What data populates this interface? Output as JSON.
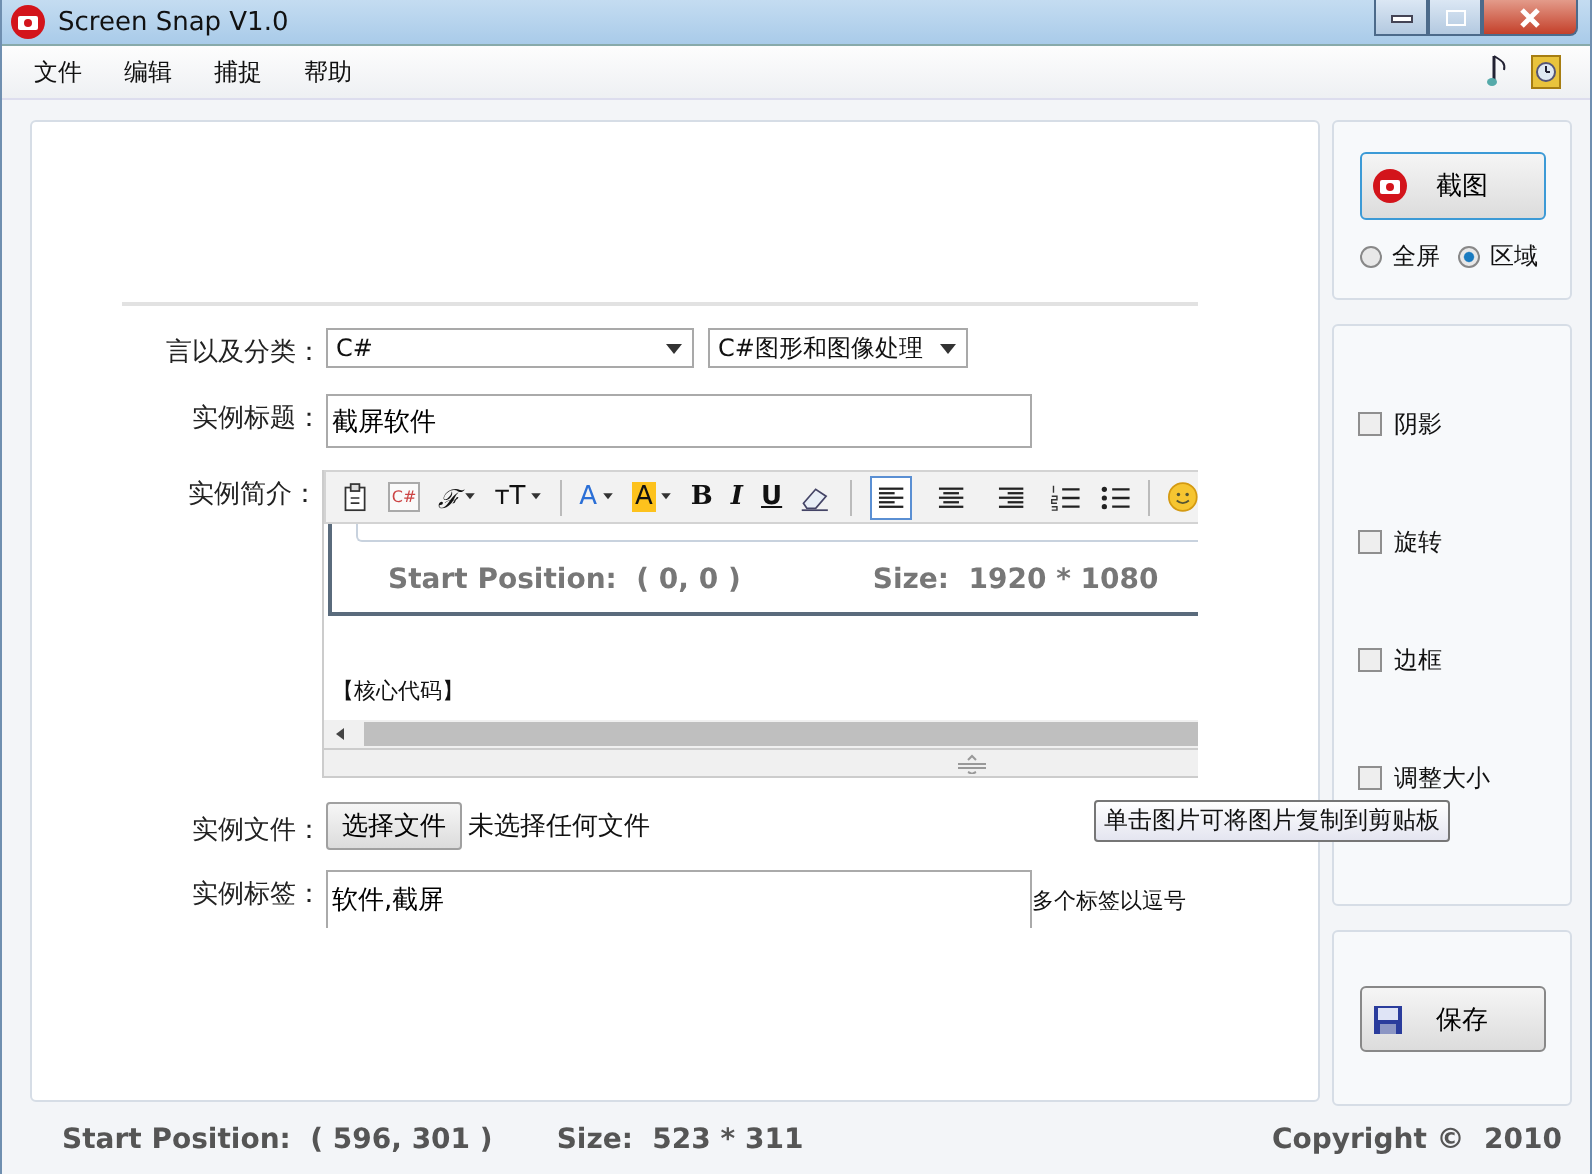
{
  "window": {
    "title": "Screen Snap V1.0"
  },
  "menu": [
    "文件",
    "编辑",
    "捕捉",
    "帮助"
  ],
  "form": {
    "category": {
      "label": "言以及分类：",
      "language": "C#",
      "subcategory": "C#图形和图像处理"
    },
    "title": {
      "label": "实例标题：",
      "value": "截屏软件"
    },
    "summary": {
      "label": "实例简介：",
      "toolbar": [
        {
          "kind": "paste"
        },
        {
          "kind": "code",
          "label": "C#"
        },
        {
          "kind": "font",
          "label": "ℱ"
        },
        {
          "kind": "size",
          "label": "ᴛT"
        },
        {
          "kind": "sep"
        },
        {
          "kind": "color",
          "label": "A"
        },
        {
          "kind": "highlight",
          "label": "A"
        },
        {
          "kind": "bold",
          "label": "B"
        },
        {
          "kind": "italic",
          "label": "I"
        },
        {
          "kind": "underline",
          "label": "U"
        },
        {
          "kind": "eraser"
        },
        {
          "kind": "sep"
        },
        {
          "kind": "align-left",
          "selected": true
        },
        {
          "kind": "align-center",
          "selected": false
        },
        {
          "kind": "align-right",
          "selected": false
        },
        {
          "kind": "numbered-list"
        },
        {
          "kind": "bullet-list"
        },
        {
          "kind": "sep"
        },
        {
          "kind": "smiley"
        }
      ],
      "start_position": "Start Position:  ( 0, 0 )",
      "size": "Size:  1920 * 1080",
      "code_heading": "【核心代码】"
    },
    "file": {
      "label": "实例文件：",
      "button": "选择文件",
      "status": "未选择任何文件"
    },
    "tags": {
      "label": "实例标签：",
      "value": "软件,截屏",
      "hint": "多个标签以逗号"
    }
  },
  "tooltip": "单击图片可将图片复制到剪贴板",
  "capture": {
    "button": "截图",
    "modes": [
      {
        "label": "全屏",
        "selected": false
      },
      {
        "label": "区域",
        "selected": true
      }
    ]
  },
  "options": [
    {
      "label": "阴影",
      "checked": false
    },
    {
      "label": "旋转",
      "checked": false
    },
    {
      "label": "边框",
      "checked": false
    },
    {
      "label": "调整大小",
      "checked": false
    }
  ],
  "save_button": "保存",
  "status_bar": {
    "start_position": "Start Position:  ( 596, 301 )",
    "size": "Size:  523 * 311",
    "copyright": "Copyright ©  2010"
  }
}
